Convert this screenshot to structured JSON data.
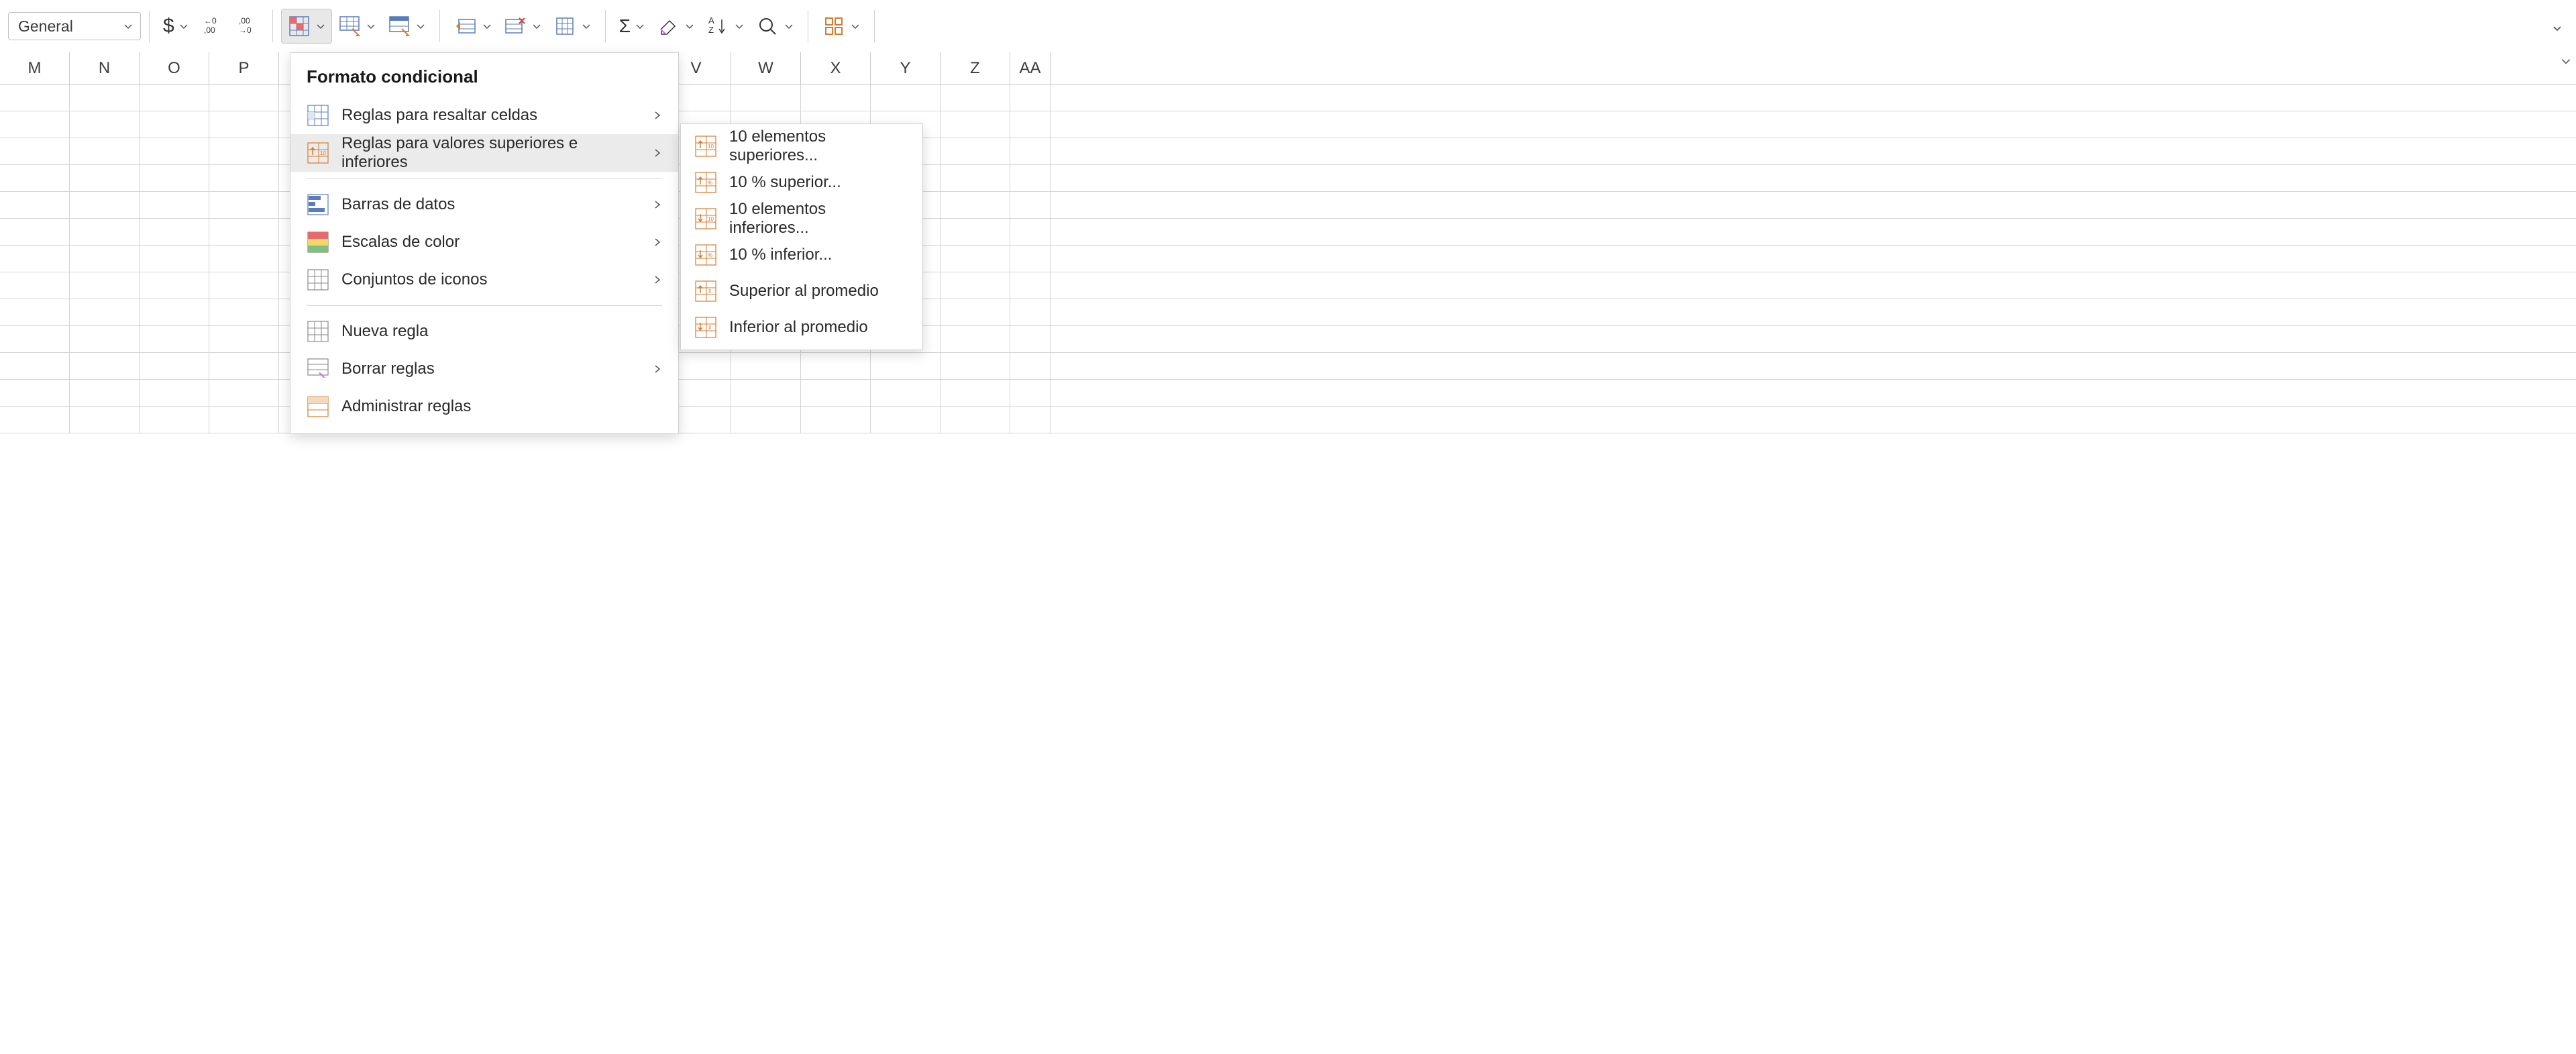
{
  "toolbar": {
    "number_format": "General"
  },
  "dropdown": {
    "title": "Formato condicional",
    "items": [
      {
        "label": "Reglas para resaltar celdas",
        "has_arrow": true
      },
      {
        "label": "Reglas para valores superiores e inferiores",
        "has_arrow": true,
        "highlighted": true
      },
      {
        "label": "Barras de datos",
        "has_arrow": true
      },
      {
        "label": "Escalas de color",
        "has_arrow": true
      },
      {
        "label": "Conjuntos de iconos",
        "has_arrow": true
      },
      {
        "label": "Nueva regla",
        "has_arrow": false
      },
      {
        "label": "Borrar reglas",
        "has_arrow": true
      },
      {
        "label": "Administrar reglas",
        "has_arrow": false
      }
    ]
  },
  "submenu": {
    "items": [
      {
        "label": "10 elementos superiores..."
      },
      {
        "label": "10 % superior..."
      },
      {
        "label": "10 elementos inferiores..."
      },
      {
        "label": "10 % inferior..."
      },
      {
        "label": "Superior al promedio"
      },
      {
        "label": "Inferior al promedio"
      }
    ]
  },
  "columns": [
    "M",
    "N",
    "O",
    "P",
    "",
    "",
    "",
    "",
    "",
    "V",
    "W",
    "X",
    "Y",
    "Z",
    "AA"
  ]
}
